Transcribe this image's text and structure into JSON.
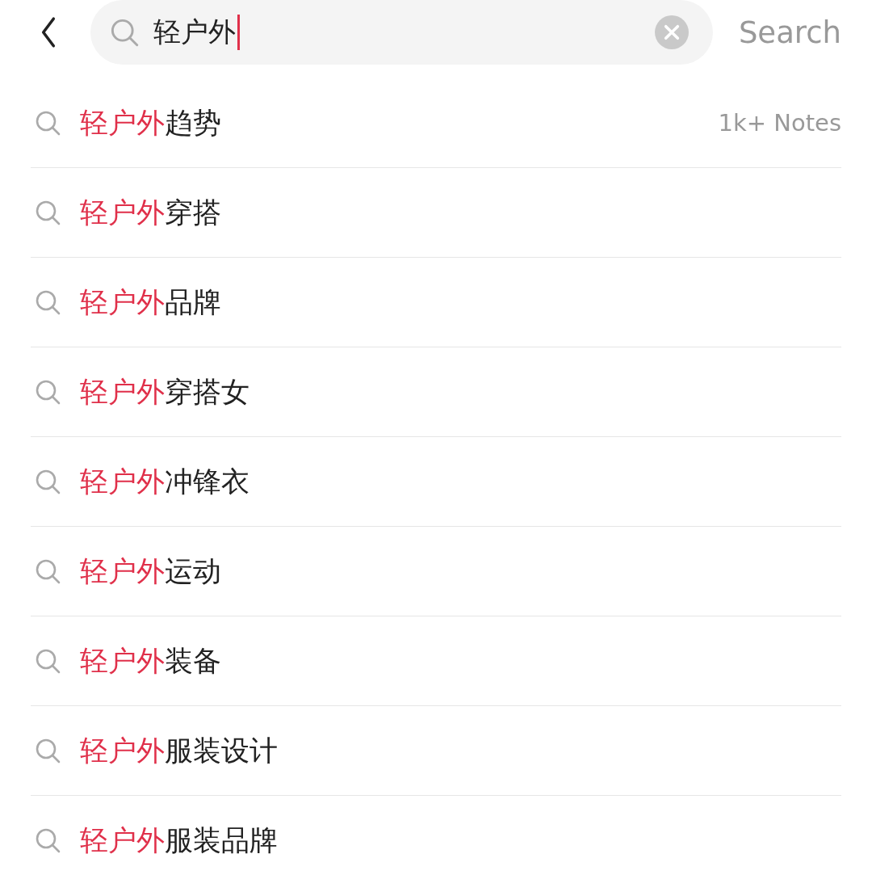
{
  "search_bar": {
    "value": "轻户外",
    "submit": "Search"
  },
  "suggestions": [
    {
      "match": "轻户外",
      "rest": "趋势",
      "count": "1k+ Notes"
    },
    {
      "match": "轻户外",
      "rest": "穿搭"
    },
    {
      "match": "轻户外",
      "rest": "品牌"
    },
    {
      "match": "轻户外",
      "rest": "穿搭女"
    },
    {
      "match": "轻户外",
      "rest": "冲锋衣"
    },
    {
      "match": "轻户外",
      "rest": "运动"
    },
    {
      "match": "轻户外",
      "rest": "装备"
    },
    {
      "match": "轻户外",
      "rest": "服装设计"
    },
    {
      "match": "轻户外",
      "rest": "服装品牌"
    }
  ]
}
